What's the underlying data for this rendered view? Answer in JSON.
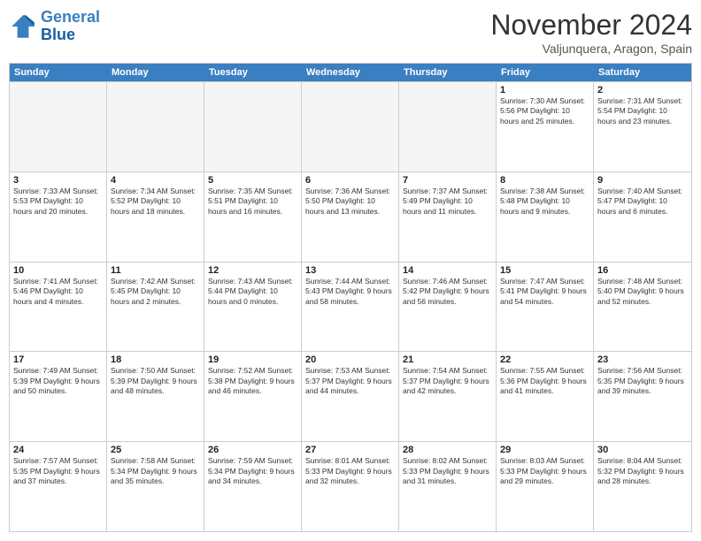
{
  "header": {
    "logo_line1": "General",
    "logo_line2": "Blue",
    "month": "November 2024",
    "location": "Valjunquera, Aragon, Spain"
  },
  "day_headers": [
    "Sunday",
    "Monday",
    "Tuesday",
    "Wednesday",
    "Thursday",
    "Friday",
    "Saturday"
  ],
  "weeks": [
    [
      {
        "num": "",
        "info": "",
        "empty": true
      },
      {
        "num": "",
        "info": "",
        "empty": true
      },
      {
        "num": "",
        "info": "",
        "empty": true
      },
      {
        "num": "",
        "info": "",
        "empty": true
      },
      {
        "num": "",
        "info": "",
        "empty": true
      },
      {
        "num": "1",
        "info": "Sunrise: 7:30 AM\nSunset: 5:56 PM\nDaylight: 10 hours\nand 25 minutes.",
        "empty": false
      },
      {
        "num": "2",
        "info": "Sunrise: 7:31 AM\nSunset: 5:54 PM\nDaylight: 10 hours\nand 23 minutes.",
        "empty": false
      }
    ],
    [
      {
        "num": "3",
        "info": "Sunrise: 7:33 AM\nSunset: 5:53 PM\nDaylight: 10 hours\nand 20 minutes.",
        "empty": false
      },
      {
        "num": "4",
        "info": "Sunrise: 7:34 AM\nSunset: 5:52 PM\nDaylight: 10 hours\nand 18 minutes.",
        "empty": false
      },
      {
        "num": "5",
        "info": "Sunrise: 7:35 AM\nSunset: 5:51 PM\nDaylight: 10 hours\nand 16 minutes.",
        "empty": false
      },
      {
        "num": "6",
        "info": "Sunrise: 7:36 AM\nSunset: 5:50 PM\nDaylight: 10 hours\nand 13 minutes.",
        "empty": false
      },
      {
        "num": "7",
        "info": "Sunrise: 7:37 AM\nSunset: 5:49 PM\nDaylight: 10 hours\nand 11 minutes.",
        "empty": false
      },
      {
        "num": "8",
        "info": "Sunrise: 7:38 AM\nSunset: 5:48 PM\nDaylight: 10 hours\nand 9 minutes.",
        "empty": false
      },
      {
        "num": "9",
        "info": "Sunrise: 7:40 AM\nSunset: 5:47 PM\nDaylight: 10 hours\nand 6 minutes.",
        "empty": false
      }
    ],
    [
      {
        "num": "10",
        "info": "Sunrise: 7:41 AM\nSunset: 5:46 PM\nDaylight: 10 hours\nand 4 minutes.",
        "empty": false
      },
      {
        "num": "11",
        "info": "Sunrise: 7:42 AM\nSunset: 5:45 PM\nDaylight: 10 hours\nand 2 minutes.",
        "empty": false
      },
      {
        "num": "12",
        "info": "Sunrise: 7:43 AM\nSunset: 5:44 PM\nDaylight: 10 hours\nand 0 minutes.",
        "empty": false
      },
      {
        "num": "13",
        "info": "Sunrise: 7:44 AM\nSunset: 5:43 PM\nDaylight: 9 hours\nand 58 minutes.",
        "empty": false
      },
      {
        "num": "14",
        "info": "Sunrise: 7:46 AM\nSunset: 5:42 PM\nDaylight: 9 hours\nand 56 minutes.",
        "empty": false
      },
      {
        "num": "15",
        "info": "Sunrise: 7:47 AM\nSunset: 5:41 PM\nDaylight: 9 hours\nand 54 minutes.",
        "empty": false
      },
      {
        "num": "16",
        "info": "Sunrise: 7:48 AM\nSunset: 5:40 PM\nDaylight: 9 hours\nand 52 minutes.",
        "empty": false
      }
    ],
    [
      {
        "num": "17",
        "info": "Sunrise: 7:49 AM\nSunset: 5:39 PM\nDaylight: 9 hours\nand 50 minutes.",
        "empty": false
      },
      {
        "num": "18",
        "info": "Sunrise: 7:50 AM\nSunset: 5:39 PM\nDaylight: 9 hours\nand 48 minutes.",
        "empty": false
      },
      {
        "num": "19",
        "info": "Sunrise: 7:52 AM\nSunset: 5:38 PM\nDaylight: 9 hours\nand 46 minutes.",
        "empty": false
      },
      {
        "num": "20",
        "info": "Sunrise: 7:53 AM\nSunset: 5:37 PM\nDaylight: 9 hours\nand 44 minutes.",
        "empty": false
      },
      {
        "num": "21",
        "info": "Sunrise: 7:54 AM\nSunset: 5:37 PM\nDaylight: 9 hours\nand 42 minutes.",
        "empty": false
      },
      {
        "num": "22",
        "info": "Sunrise: 7:55 AM\nSunset: 5:36 PM\nDaylight: 9 hours\nand 41 minutes.",
        "empty": false
      },
      {
        "num": "23",
        "info": "Sunrise: 7:56 AM\nSunset: 5:35 PM\nDaylight: 9 hours\nand 39 minutes.",
        "empty": false
      }
    ],
    [
      {
        "num": "24",
        "info": "Sunrise: 7:57 AM\nSunset: 5:35 PM\nDaylight: 9 hours\nand 37 minutes.",
        "empty": false
      },
      {
        "num": "25",
        "info": "Sunrise: 7:58 AM\nSunset: 5:34 PM\nDaylight: 9 hours\nand 35 minutes.",
        "empty": false
      },
      {
        "num": "26",
        "info": "Sunrise: 7:59 AM\nSunset: 5:34 PM\nDaylight: 9 hours\nand 34 minutes.",
        "empty": false
      },
      {
        "num": "27",
        "info": "Sunrise: 8:01 AM\nSunset: 5:33 PM\nDaylight: 9 hours\nand 32 minutes.",
        "empty": false
      },
      {
        "num": "28",
        "info": "Sunrise: 8:02 AM\nSunset: 5:33 PM\nDaylight: 9 hours\nand 31 minutes.",
        "empty": false
      },
      {
        "num": "29",
        "info": "Sunrise: 8:03 AM\nSunset: 5:33 PM\nDaylight: 9 hours\nand 29 minutes.",
        "empty": false
      },
      {
        "num": "30",
        "info": "Sunrise: 8:04 AM\nSunset: 5:32 PM\nDaylight: 9 hours\nand 28 minutes.",
        "empty": false
      }
    ]
  ]
}
